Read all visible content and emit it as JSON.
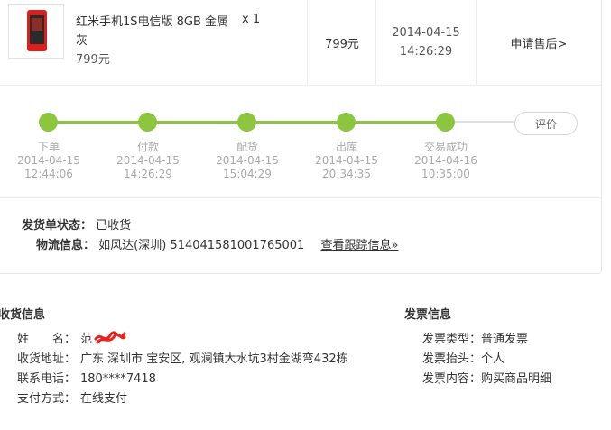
{
  "product": {
    "name": "红米手机1S电信版 8GB 金属灰",
    "price": "799元",
    "qty": "x 1",
    "unit_price": "799元",
    "order_date": "2014-04-15",
    "order_time": "14:26:29",
    "action": "申请售后>"
  },
  "progress": {
    "steps": [
      {
        "label": "下单",
        "date": "2014-04-15",
        "time": "12:44:06"
      },
      {
        "label": "付款",
        "date": "2014-04-15",
        "time": "14:26:29"
      },
      {
        "label": "配货",
        "date": "2014-04-15",
        "time": "15:04:29"
      },
      {
        "label": "出库",
        "date": "2014-04-15",
        "time": "20:34:35"
      },
      {
        "label": "交易成功",
        "date": "2014-04-16",
        "time": "10:35:00"
      }
    ],
    "rate_label": "评价"
  },
  "shipping": {
    "status_key": "发货单状态：",
    "status_value": "已收货",
    "logistics_key": "物流信息：",
    "logistics_value": "如风达(深圳) 514041581001765001",
    "track_link": "查看跟踪信息»"
  },
  "receiver": {
    "title": "收货信息",
    "name_key": "姓　　名：",
    "name_value": "范",
    "address_key": "收货地址：",
    "address_value": "广东 深圳市 宝安区, 观澜镇大水坑3村金湖弯432栋",
    "phone_key": "联系电话：",
    "phone_value": "180****7418",
    "pay_key": "支付方式：",
    "pay_value": "在线支付"
  },
  "invoice": {
    "title": "发票信息",
    "type_key": "发票类型：",
    "type_value": "普通发票",
    "head_key": "发票抬头：",
    "head_value": "个人",
    "content_key": "发票内容：",
    "content_value": "购买商品明细"
  },
  "colors": {
    "progress_green": "#8cc63f",
    "scribble_red": "#e8231f"
  }
}
